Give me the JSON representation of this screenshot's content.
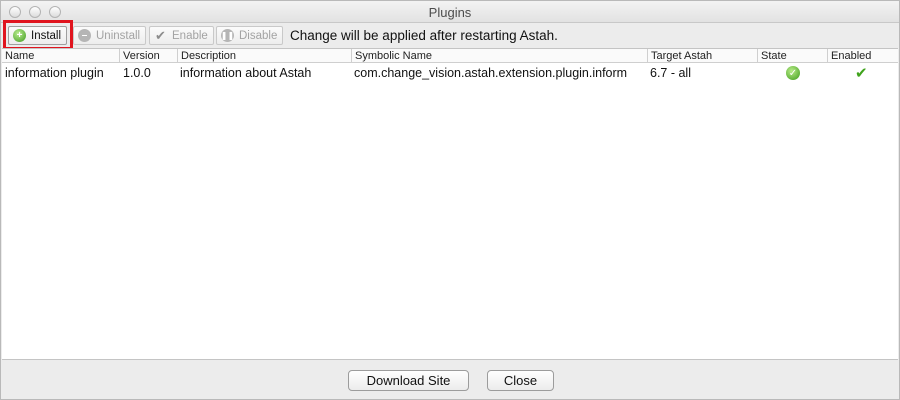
{
  "window": {
    "title": "Plugins"
  },
  "toolbar": {
    "buttons": [
      {
        "label": "Install",
        "icon": "plus-circle-icon",
        "enabled": true
      },
      {
        "label": "Uninstall",
        "icon": "minus-circle-icon",
        "enabled": false
      },
      {
        "label": "Enable",
        "icon": "checkmark-icon",
        "enabled": false
      },
      {
        "label": "Disable",
        "icon": "pause-circle-icon",
        "enabled": false
      }
    ],
    "notice": "Change will be applied after restarting Astah.",
    "highlight_color": "#e0141e"
  },
  "table": {
    "columns": [
      "Name",
      "Version",
      "Description",
      "Symbolic Name",
      "Target Astah",
      "State",
      "Enabled"
    ],
    "rows": [
      {
        "name": "information plugin",
        "version": "1.0.0",
        "description": "information about Astah",
        "symbolic_name": "com.change_vision.astah.extension.plugin.inform",
        "target_astah": "6.7 - all",
        "state_icon": "green-check-circle-icon",
        "enabled_icon": "green-checkmark-icon"
      }
    ]
  },
  "footer": {
    "download_label": "Download Site",
    "close_label": "Close"
  }
}
